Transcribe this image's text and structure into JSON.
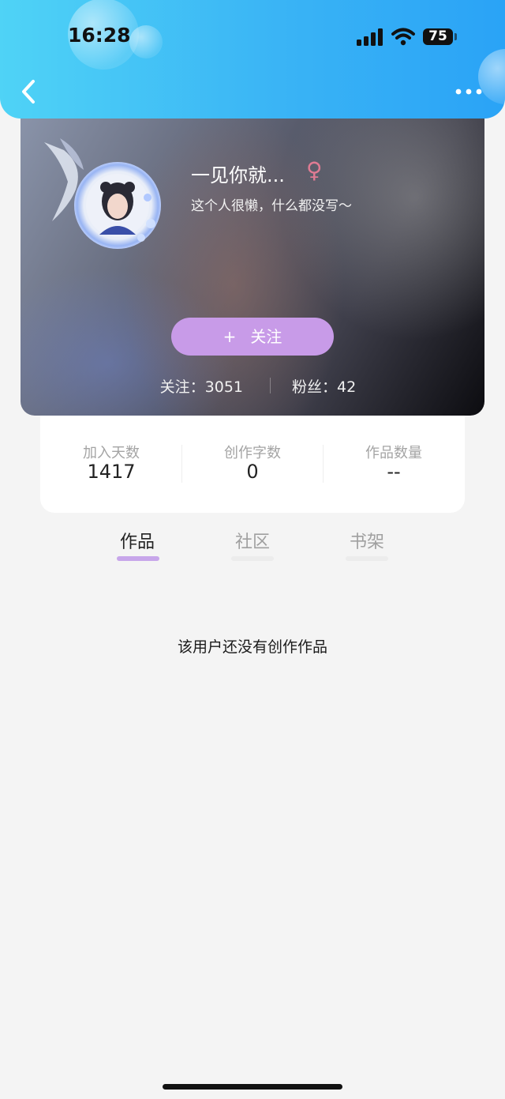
{
  "status_bar": {
    "time": "16:28",
    "battery": "75"
  },
  "nav": {
    "back_icon": "chevron-left-icon",
    "more_icon": "more-dots-icon"
  },
  "profile": {
    "nickname": "一见你就...",
    "gender_symbol": "♀",
    "gender_color": "#e07b93",
    "bio": "这个人很懒，什么都没写～",
    "follow_button": {
      "plus": "+",
      "label": "关注",
      "color": "#c89be8"
    },
    "following": "关注：3051",
    "fans": "粉丝：42"
  },
  "stats": [
    {
      "label": "加入天数",
      "value": "1417"
    },
    {
      "label": "创作字数",
      "value": "0"
    },
    {
      "label": "作品数量",
      "value": "--"
    }
  ],
  "tabs": [
    {
      "label": "作品",
      "active": true
    },
    {
      "label": "社区",
      "active": false
    },
    {
      "label": "书架",
      "active": false
    }
  ],
  "accent_color": "#c7a6ea",
  "empty_message": "该用户还没有创作作品"
}
